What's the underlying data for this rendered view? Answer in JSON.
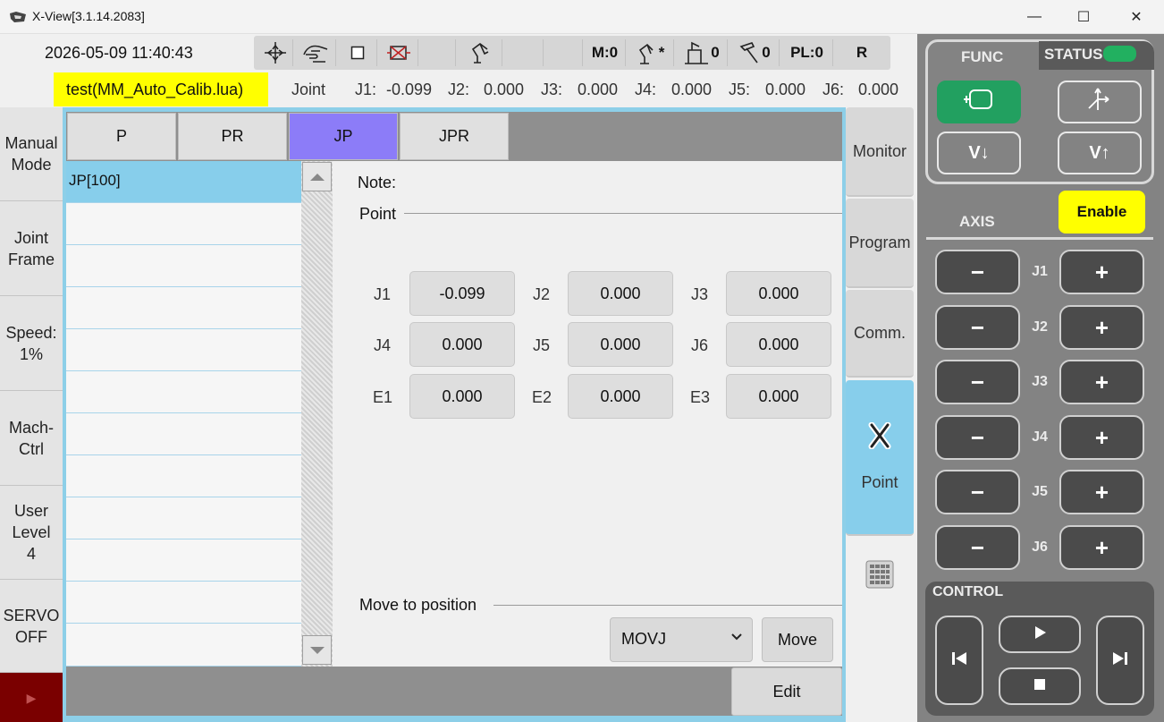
{
  "window": {
    "title": "X-View[3.1.14.2083]",
    "minimize": "—",
    "maximize": "☐",
    "close": "✕"
  },
  "status": {
    "datetime": "2026-05-09 11:40:43",
    "m_count": "M:0",
    "robot_label": "*",
    "box_count": "0",
    "hammer_count": "0",
    "pl": "PL:0",
    "r": "R"
  },
  "file": {
    "name": "test(MM_Auto_Calib.lua)"
  },
  "joint_readout": {
    "mode": "Joint",
    "items": [
      {
        "label": "J1:",
        "value": "-0.099"
      },
      {
        "label": "J2:",
        "value": "0.000"
      },
      {
        "label": "J3:",
        "value": "0.000"
      },
      {
        "label": "J4:",
        "value": "0.000"
      },
      {
        "label": "J5:",
        "value": "0.000"
      },
      {
        "label": "J6:",
        "value": "0.000"
      }
    ]
  },
  "sidebar": {
    "items": [
      {
        "label": "Manual\nMode"
      },
      {
        "label": "Joint\nFrame"
      },
      {
        "label": "Speed:\n1%"
      },
      {
        "label": "Mach-\nCtrl"
      },
      {
        "label": "User\nLevel\n4"
      },
      {
        "label": "SERVO\nOFF"
      },
      {
        "label": "▶"
      }
    ]
  },
  "tabs": [
    {
      "label": "P"
    },
    {
      "label": "PR"
    },
    {
      "label": "JP"
    },
    {
      "label": "JPR"
    }
  ],
  "list": {
    "items": [
      "JP[100]",
      "",
      "",
      "",
      "",
      "",
      "",
      "",
      "",
      "",
      "",
      ""
    ]
  },
  "detail": {
    "note_label": "Note:",
    "point_label": "Point",
    "fields": [
      {
        "label": "J1",
        "value": "-0.099"
      },
      {
        "label": "J2",
        "value": "0.000"
      },
      {
        "label": "J3",
        "value": "0.000"
      },
      {
        "label": "J4",
        "value": "0.000"
      },
      {
        "label": "J5",
        "value": "0.000"
      },
      {
        "label": "J6",
        "value": "0.000"
      },
      {
        "label": "E1",
        "value": "0.000"
      },
      {
        "label": "E2",
        "value": "0.000"
      },
      {
        "label": "E3",
        "value": "0.000"
      }
    ],
    "move_label": "Move to position",
    "move_type": "MOVJ",
    "move_button": "Move",
    "edit_button": "Edit"
  },
  "rightnav": {
    "items": [
      {
        "label": "Monitor"
      },
      {
        "label": "Program"
      },
      {
        "label": "Comm."
      },
      {
        "label": "Point"
      }
    ]
  },
  "panel": {
    "func_tab": "FUNC",
    "status_tab": "STATUS",
    "v_down": "V↓",
    "v_up": "V↑",
    "axis_label": "AXIS",
    "enable": "Enable",
    "minus": "−",
    "plus": "+",
    "joints": [
      "J1",
      "J2",
      "J3",
      "J4",
      "J5",
      "J6"
    ],
    "control_label": "CONTROL",
    "status_color": "#22b060",
    "func_active_color": "#22a060"
  }
}
